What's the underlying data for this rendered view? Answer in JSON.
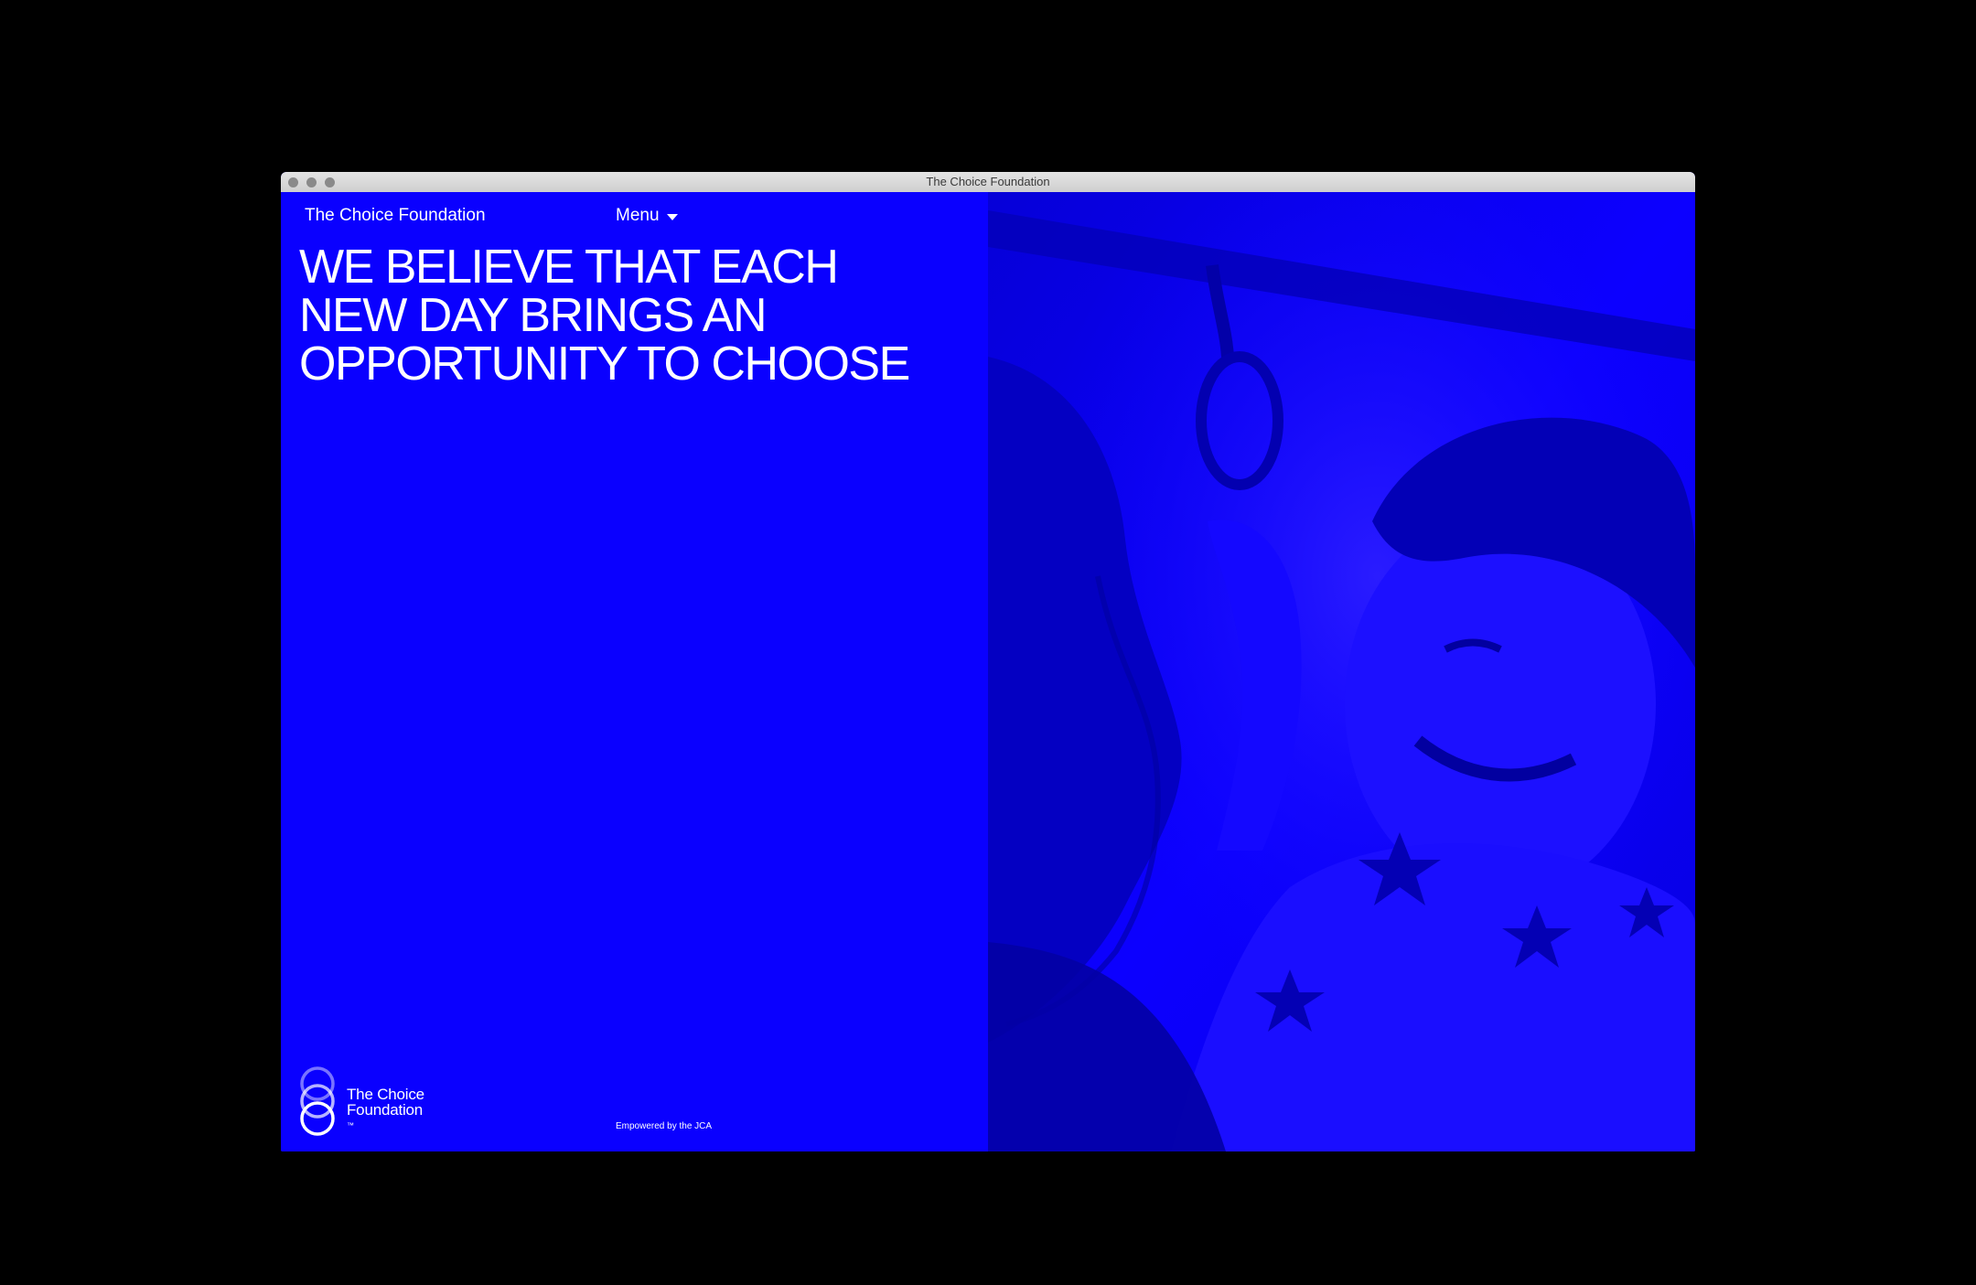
{
  "window": {
    "title": "The Choice Foundation"
  },
  "nav": {
    "brand": "The Choice Foundation",
    "menu_label": "Menu",
    "menu_icon": "chevron-down-icon"
  },
  "hero": {
    "lines": [
      "WE BELIEVE THAT EACH",
      "NEW DAY BRINGS AN",
      "OPPORTUNITY TO CHOOSE"
    ]
  },
  "footer": {
    "logo_line1": "The Choice",
    "logo_line2": "Foundation",
    "logo_tm": "™",
    "empowered": "Empowered by the JCA"
  },
  "theme": {
    "accent": "#0a00ff",
    "text": "#ffffff",
    "background": "#000000"
  }
}
